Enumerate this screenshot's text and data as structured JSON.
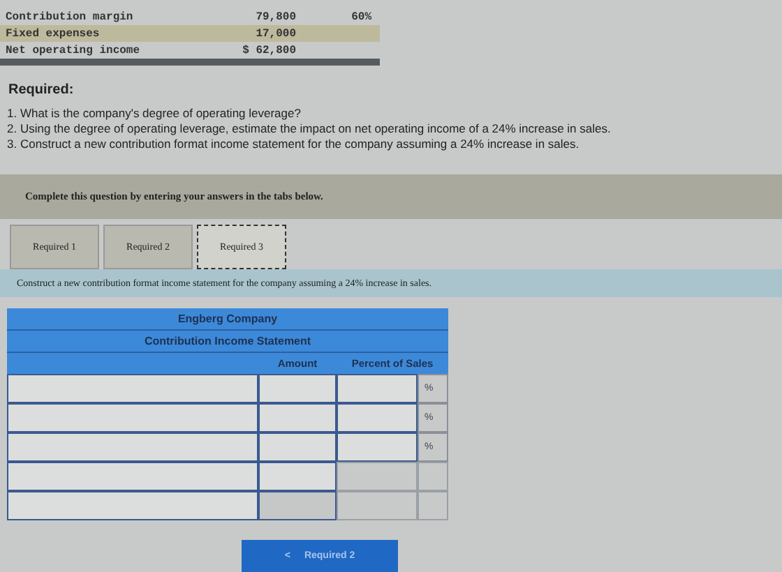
{
  "summary": [
    {
      "label": "Contribution margin",
      "amount": "79,800",
      "percent": "60%",
      "highlighted": false
    },
    {
      "label": "Fixed expenses",
      "amount": "17,000",
      "highlighted": true
    },
    {
      "label": "Net operating income",
      "amount": "$ 62,800",
      "highlighted": false
    }
  ],
  "required_heading": "Required:",
  "questions": [
    "1. What is the company's degree of operating leverage?",
    "2. Using the degree of operating leverage, estimate the impact on net operating income of a 24% increase in sales.",
    "3. Construct a new contribution format income statement for the company assuming a 24% increase in sales."
  ],
  "banner": "Complete this question by entering your answers in the tabs below.",
  "tabs": [
    {
      "label": "Required 1",
      "selected": false
    },
    {
      "label": "Required 2",
      "selected": false
    },
    {
      "label": "Required 3",
      "selected": true
    }
  ],
  "instruction": "Construct a new contribution format income statement for the company assuming a 24% increase in sales.",
  "statement": {
    "company": "Engberg Company",
    "title": "Contribution Income Statement",
    "columns": [
      "Amount",
      "Percent of Sales"
    ],
    "rows": [
      {
        "kind": "percent",
        "percent_sign": "%"
      },
      {
        "kind": "percent",
        "percent_sign": "%"
      },
      {
        "kind": "percent",
        "percent_sign": "%"
      },
      {
        "kind": "amount"
      },
      {
        "kind": "label"
      }
    ]
  },
  "prev_button": {
    "arrow": "<",
    "label": "Required 2"
  }
}
